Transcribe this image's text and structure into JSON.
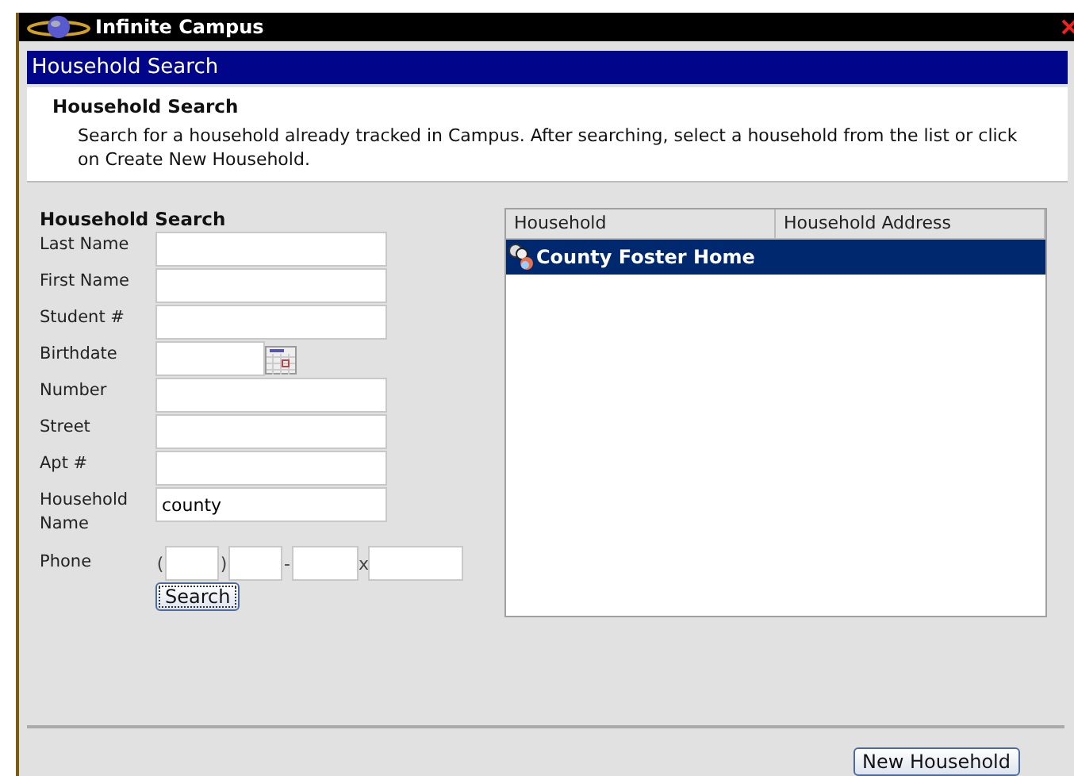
{
  "window": {
    "title": "Infinite Campus"
  },
  "header": {
    "title": "Household Search"
  },
  "intro": {
    "title": "Household Search",
    "text": "Search for a household already tracked in Campus. After searching, select a household from the list or click on Create New Household."
  },
  "form": {
    "title": "Household Search",
    "fields": [
      {
        "label": "Last Name",
        "kind": "text"
      },
      {
        "label": "First Name",
        "kind": "text"
      },
      {
        "label": "Student #",
        "kind": "text"
      },
      {
        "label": "Birthdate",
        "kind": "date"
      },
      {
        "label": "Number",
        "kind": "text"
      },
      {
        "label": "Street",
        "kind": "text"
      },
      {
        "label": "Apt #",
        "kind": "text"
      },
      {
        "label": "Household Name",
        "kind": "text",
        "value": "county"
      },
      {
        "label": "Phone",
        "kind": "phone",
        "separators": [
          "(",
          ")",
          "-",
          "x"
        ]
      }
    ],
    "search_button": "Search"
  },
  "results": {
    "columns": [
      "Household",
      "Household Address"
    ],
    "rows": [
      {
        "household": "County Foster Home",
        "selected": true
      }
    ]
  },
  "new_button": "New Household"
}
